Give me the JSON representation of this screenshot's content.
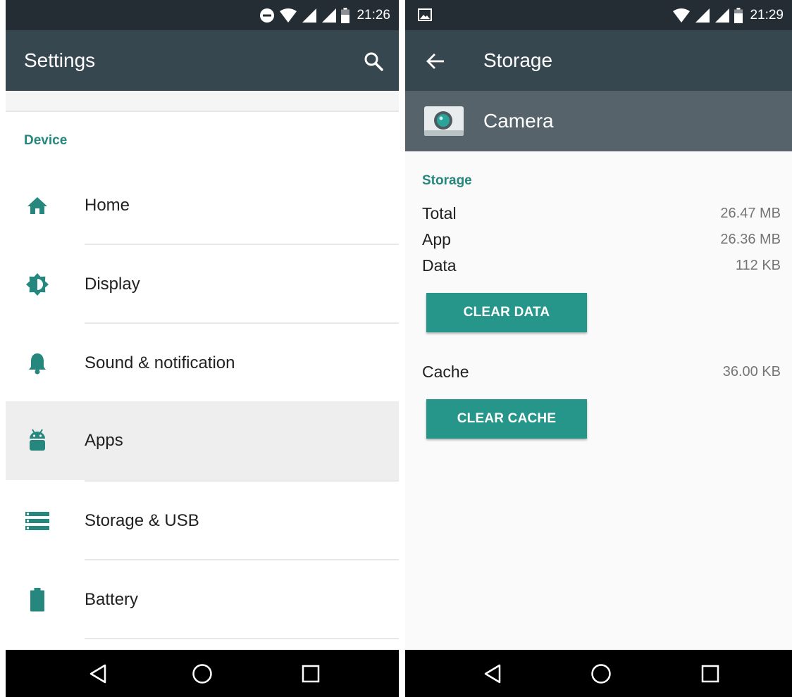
{
  "left_screen": {
    "status_bar": {
      "time": "21:26",
      "icons": [
        "do-not-disturb-icon",
        "wifi-icon",
        "signal-icon",
        "signal-icon",
        "battery-icon"
      ]
    },
    "app_bar": {
      "title": "Settings",
      "action_icon": "search-icon"
    },
    "section": {
      "label": "Device"
    },
    "items": [
      {
        "label": "Home",
        "icon": "home-icon",
        "active": false
      },
      {
        "label": "Display",
        "icon": "brightness-icon",
        "active": false
      },
      {
        "label": "Sound & notification",
        "icon": "bell-icon",
        "active": false
      },
      {
        "label": "Apps",
        "icon": "android-icon",
        "active": true
      },
      {
        "label": "Storage & USB",
        "icon": "storage-icon",
        "active": false
      },
      {
        "label": "Battery",
        "icon": "battery-icon",
        "active": false
      }
    ],
    "nav_bar": [
      "back-icon",
      "home-circle-icon",
      "recents-icon"
    ]
  },
  "right_screen": {
    "status_bar": {
      "time": "21:29",
      "icons": [
        "image-notification-icon",
        "wifi-icon",
        "signal-icon",
        "signal-icon",
        "battery-icon"
      ]
    },
    "app_bar": {
      "title": "Storage",
      "nav_icon": "back-arrow-icon"
    },
    "app_header": {
      "name": "Camera",
      "icon": "camera-app-icon"
    },
    "section": {
      "label": "Storage"
    },
    "rows": [
      {
        "label": "Total",
        "value": "26.47 MB"
      },
      {
        "label": "App",
        "value": "26.36 MB"
      },
      {
        "label": "Data",
        "value": "112 KB"
      }
    ],
    "clear_data_button": "CLEAR DATA",
    "cache": {
      "label": "Cache",
      "value": "36.00 KB"
    },
    "clear_cache_button": "CLEAR CACHE",
    "nav_bar": [
      "back-icon",
      "home-circle-icon",
      "recents-icon"
    ]
  },
  "colors": {
    "status_bar": "#242d33",
    "app_bar": "#37474f",
    "app_header": "#56636b",
    "accent": "#26877f",
    "button": "#26968a",
    "active_row": "#eeeeee"
  }
}
